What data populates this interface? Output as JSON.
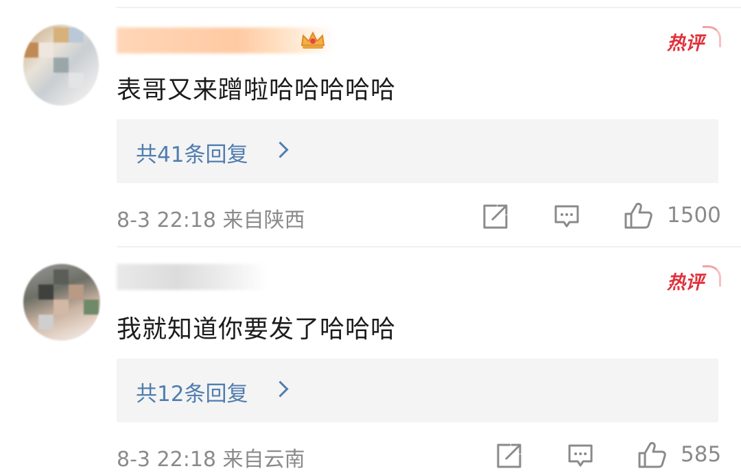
{
  "colors": {
    "reply_link": "#507daf",
    "hot_badge": "#e0303b",
    "meta_text": "#8a8a8a",
    "reply_bg": "#f4f4f4"
  },
  "comments": [
    {
      "username": "",
      "has_crown_icon": true,
      "hot_badge": "热评",
      "text": "表哥又来蹭啦哈哈哈哈哈",
      "replies_label": "共41条回复",
      "time": "8-3 22:18",
      "location": "来自陕西",
      "meta": "8-3 22:18  来自陕西",
      "likes": "1500",
      "icons": [
        "share-icon",
        "comment-icon",
        "like-icon"
      ]
    },
    {
      "username": "",
      "has_crown_icon": false,
      "hot_badge": "热评",
      "text": "我就知道你要发了哈哈哈",
      "replies_label": "共12条回复",
      "time": "8-3 22:18",
      "location": "来自云南",
      "meta": "8-3 22:18  来自云南",
      "likes": "585",
      "icons": [
        "share-icon",
        "comment-icon",
        "like-icon"
      ]
    }
  ]
}
